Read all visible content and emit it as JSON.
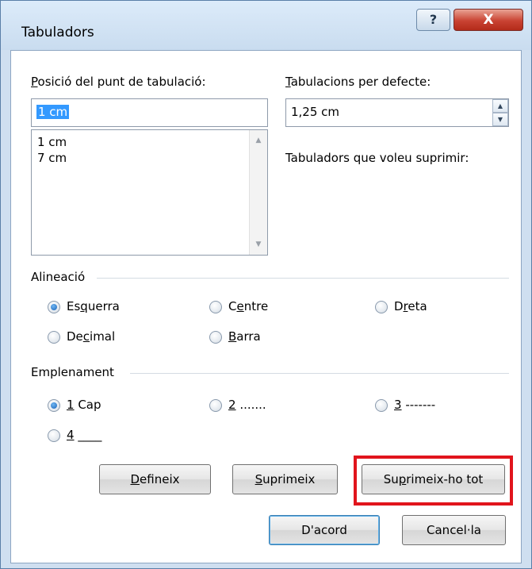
{
  "window": {
    "title": "Tabuladors",
    "help_glyph": "?",
    "close_glyph": "X"
  },
  "tab_position": {
    "label_u": "P",
    "label_rest": "osició del punt de tabulació:",
    "value": "1 cm",
    "list": [
      "1 cm",
      "7 cm"
    ]
  },
  "default_tabs": {
    "label_u": "T",
    "label_rest": "abulacions per defecte:",
    "value": "1,25 cm"
  },
  "tabs_to_clear": {
    "label": "Tabuladors que voleu suprimir:"
  },
  "alignment": {
    "heading": "Alineació",
    "options": [
      {
        "pre": "Es",
        "u": "q",
        "post": "uerra",
        "checked": true
      },
      {
        "pre": "C",
        "u": "e",
        "post": "ntre",
        "checked": false
      },
      {
        "pre": "D",
        "u": "r",
        "post": "eta",
        "checked": false
      },
      {
        "pre": "De",
        "u": "c",
        "post": "imal",
        "checked": false
      },
      {
        "pre": "",
        "u": "B",
        "post": "arra",
        "checked": false
      }
    ]
  },
  "leader": {
    "heading": "Emplenament",
    "options": [
      {
        "u": "1",
        "post": " Cap",
        "checked": true
      },
      {
        "u": "2",
        "post": " .......",
        "checked": false
      },
      {
        "u": "3",
        "post": " -------",
        "checked": false
      },
      {
        "u": "4",
        "post": " ____",
        "checked": false
      }
    ]
  },
  "buttons": {
    "set": {
      "u": "D",
      "post": "efineix"
    },
    "clear": {
      "u": "S",
      "post": "uprimeix"
    },
    "clear_all": {
      "pre": "Su",
      "u": "p",
      "post": "rimeix-ho tot"
    },
    "ok": "D'acord",
    "cancel": "Cancel·la"
  },
  "colors": {
    "highlight": "#e1141c",
    "selection": "#3399ff"
  }
}
